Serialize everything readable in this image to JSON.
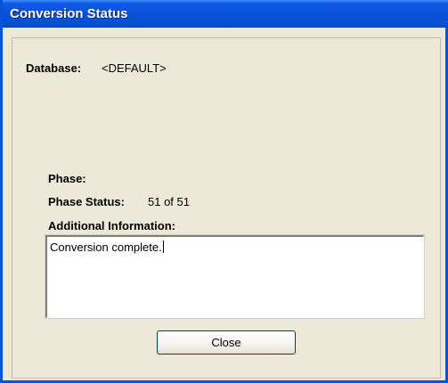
{
  "window": {
    "title": "Conversion Status",
    "colors": {
      "titlebar": "#0a4fd9",
      "frame": "#0a53d8",
      "face": "#ece9d8"
    }
  },
  "database": {
    "label": "Database:",
    "value": "<DEFAULT>"
  },
  "phase": {
    "label": "Phase:"
  },
  "phase_status": {
    "label": "Phase Status:",
    "value": "51 of 51"
  },
  "additional_info": {
    "label": "Additional Information:",
    "text": "Conversion complete."
  },
  "buttons": {
    "close_label": "Close"
  }
}
